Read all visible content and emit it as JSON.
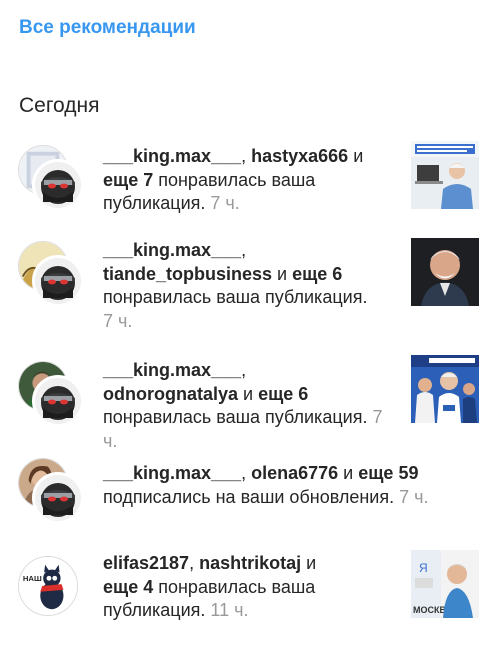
{
  "header": {
    "all_recommendations": "Все рекомендации"
  },
  "section": {
    "title": "Сегодня"
  },
  "notifications": [
    {
      "user1": "___king.max___",
      "sep1": ", ",
      "user2": "hastyxa666",
      "mid": " и ",
      "more": "еще 7",
      "action": " понравилась ваша публикация.",
      "time": " 7 ч.",
      "thumb_icon": "photo-man-at-laptop"
    },
    {
      "user1": "___king.max___",
      "sep1": ", ",
      "user2": "tiande_topbusiness",
      "mid": " и ",
      "more": "еще 6",
      "action": " понравилась ваша публикация.",
      "time": " 7 ч.",
      "thumb_icon": "photo-smiling-man"
    },
    {
      "user1": "___king.max___",
      "sep1": ", ",
      "user2": "odnorognatalya",
      "mid": " и ",
      "more": "еще 6",
      "action": " понравилась ваша публикация.",
      "time": " 7 ч.",
      "thumb_icon": "photo-sports-fans"
    },
    {
      "user1": "___king.max___",
      "sep1": ", ",
      "user2": "olena6776",
      "mid": " и ",
      "more": "еще 59",
      "action": " подписались на ваши обновления.",
      "time": " 7 ч.",
      "thumb_icon": ""
    },
    {
      "user1": "elifas2187",
      "sep1": ", ",
      "user2": "nashtrikotaj",
      "mid": " и ",
      "more": "еще 4",
      "action": " понравилась ваша публикация.",
      "time": " 11 ч.",
      "avatar_badge": "НАШ",
      "thumb_caption": "МОСКВУ",
      "thumb_letter": "Я",
      "thumb_icon": "photo-man-moscow"
    }
  ]
}
